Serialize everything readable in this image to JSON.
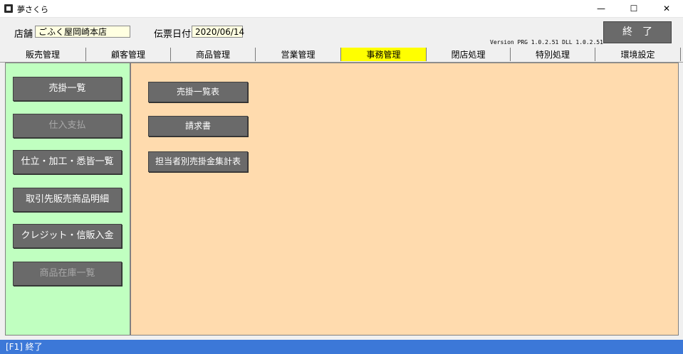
{
  "window": {
    "title": "夢さくら",
    "minimize_glyph": "—",
    "maximize_glyph": "☐",
    "close_glyph": "✕"
  },
  "header": {
    "store_label": "店舗",
    "store_value": "ごふく屋岡崎本店",
    "date_label": "伝票日付",
    "date_value": "2020/06/14",
    "version": "Version PRG 1.0.2.51 DLL 1.0.2.51",
    "exit_label": "終了"
  },
  "tabs": [
    {
      "label": "販売管理",
      "active": false
    },
    {
      "label": "顧客管理",
      "active": false
    },
    {
      "label": "商品管理",
      "active": false
    },
    {
      "label": "営業管理",
      "active": false
    },
    {
      "label": "事務管理",
      "active": true
    },
    {
      "label": "閉店処理",
      "active": false
    },
    {
      "label": "特別処理",
      "active": false
    },
    {
      "label": "環境設定",
      "active": false
    }
  ],
  "sidebar": {
    "items": [
      {
        "label": "売掛一覧",
        "enabled": true
      },
      {
        "label": "仕入支払",
        "enabled": false
      },
      {
        "label": "仕立・加工・悉皆一覧",
        "enabled": true
      },
      {
        "label": "取引先販売商品明細",
        "enabled": true
      },
      {
        "label": "クレジット・信販入金",
        "enabled": true
      },
      {
        "label": "商品在庫一覧",
        "enabled": false
      }
    ]
  },
  "main": {
    "buttons": [
      {
        "label": "売掛一覧表"
      },
      {
        "label": "請求書"
      },
      {
        "label": "担当者別売掛金集計表"
      }
    ]
  },
  "status": {
    "text": "[F1] 終了"
  },
  "colors": {
    "active_tab": "#ffff00",
    "left_panel": "#c0ffc0",
    "right_panel": "#ffdbae",
    "status_bar": "#3c78d8",
    "button": "#6a6a6a"
  }
}
